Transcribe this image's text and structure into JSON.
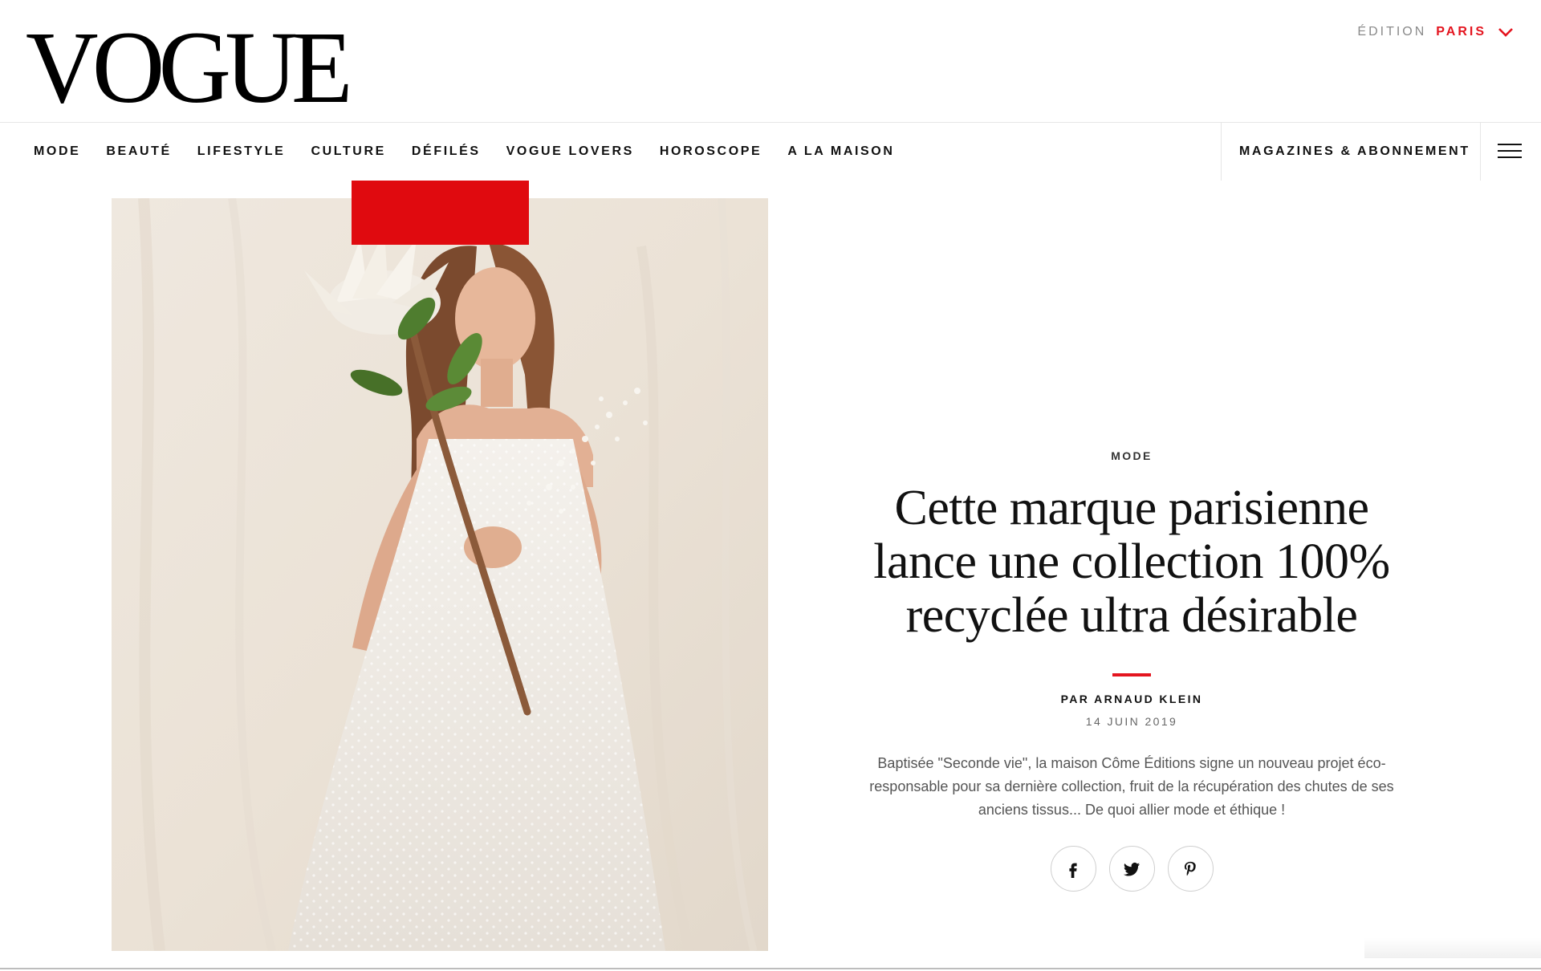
{
  "brand": {
    "logo_text": "VOGUE"
  },
  "edition": {
    "label": "ÉDITION",
    "city": "PARIS",
    "icon": "chevron-down-icon",
    "accent_color": "#e4151f"
  },
  "nav": {
    "items": [
      {
        "label": "MODE"
      },
      {
        "label": "BEAUTÉ"
      },
      {
        "label": "LIFESTYLE"
      },
      {
        "label": "CULTURE"
      },
      {
        "label": "DÉFILÉS"
      },
      {
        "label": "VOGUE LOVERS"
      },
      {
        "label": "HOROSCOPE"
      },
      {
        "label": "A LA MAISON"
      }
    ],
    "subscription_label": "MAGAZINES & ABONNEMENT",
    "menu_icon": "hamburger-menu-icon"
  },
  "article": {
    "category": "MODE",
    "headline": "Cette marque parisienne lance une collection 100% recyclée ultra désirable",
    "byline": "PAR ARNAUD KLEIN",
    "date": "14 JUIN 2019",
    "dek": "Baptisée \"Seconde vie\", la maison Côme Éditions signe un nouveau projet éco-responsable pour sa dernière collection, fruit de la récupération des chutes de ses anciens tissus... De quoi allier mode et éthique !",
    "share": [
      {
        "network": "facebook",
        "icon": "facebook-icon"
      },
      {
        "network": "twitter",
        "icon": "twitter-icon"
      },
      {
        "network": "pinterest",
        "icon": "pinterest-icon"
      }
    ]
  },
  "colors": {
    "accent": "#e4151f",
    "text": "#111111",
    "muted": "#8a8a8a",
    "divider": "#e6e6e6"
  }
}
